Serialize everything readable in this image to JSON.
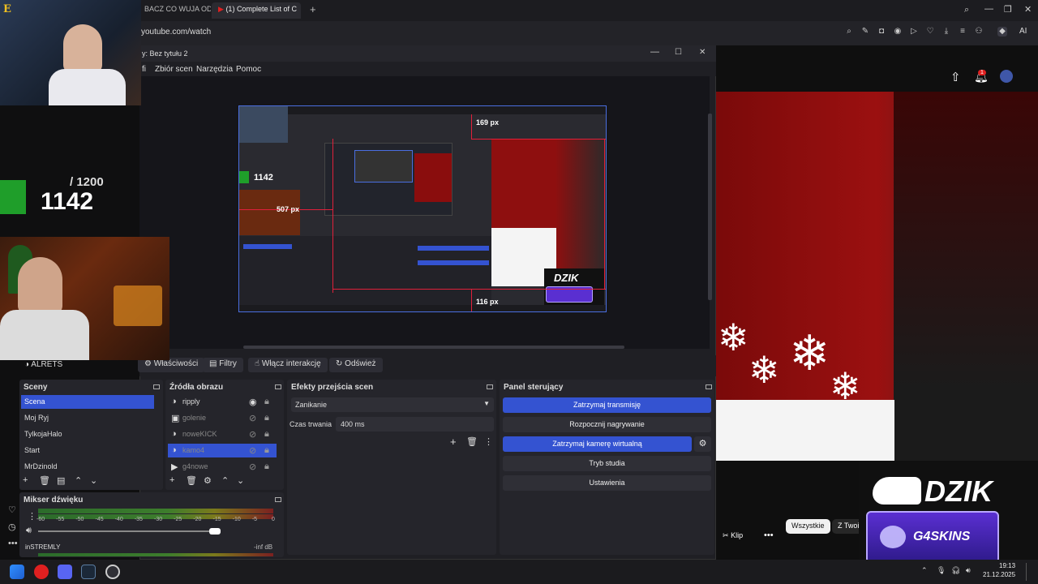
{
  "browser": {
    "tabs": [
      {
        "label": "BACZ CO WUJA ODPIE"
      },
      {
        "label": "(1) Complete List of C"
      }
    ],
    "new_tab_label": "+",
    "url": "youtube.com/watch",
    "ai_label": "AI"
  },
  "obs": {
    "window_title": "y: Bez tytułu 2",
    "menu": [
      "fi",
      "Zbiór scen",
      "Narzędzia",
      "Pomoc"
    ],
    "preview": {
      "measure_top": "169 px",
      "measure_left": "507 px",
      "measure_bottom": "116 px",
      "counter_value": "1142"
    },
    "selected_source_label": "ALRETS",
    "toolbar": {
      "properties": "Właściwości",
      "filters": "Filtry",
      "interact": "Włącz interakcję",
      "refresh": "Odśwież"
    },
    "scenes": {
      "title": "Sceny",
      "items": [
        "Scena",
        "Moj Ryj",
        "TylkojaHalo",
        "Start",
        "MrDzinold"
      ]
    },
    "sources": {
      "title": "Źródła obrazu",
      "items": [
        "ripply",
        "golenie",
        "noweKICK",
        "kamo4",
        "g4nowe"
      ]
    },
    "transitions": {
      "title": "Efekty przejścia scen",
      "selected": "Zanikanie",
      "duration_label": "Czas trwania",
      "duration_value": "400 ms"
    },
    "controls": {
      "title": "Panel sterujący",
      "stop_stream": "Zatrzymaj transmisję",
      "start_recording": "Rozpocznij nagrywanie",
      "stop_virtual_cam": "Zatrzymaj kamerę wirtualną",
      "studio_mode": "Tryb studia",
      "settings": "Ustawienia"
    },
    "mixer": {
      "title": "Mikser dźwięku",
      "ticks": [
        "-60",
        "-55",
        "-50",
        "-45",
        "-40",
        "-35",
        "-30",
        "-25",
        "-20",
        "-15",
        "-10",
        "-5",
        "0"
      ],
      "channel2_name": "inSTREMLY",
      "channel2_level": "-inf dB"
    }
  },
  "overlay": {
    "counter": "1142",
    "counter_total": "/ 1200",
    "brand": "DZIK",
    "sponsor": "G4SKINS"
  },
  "youtube": {
    "notification_count": "1",
    "chips": [
      "Wszystkie",
      "Z Twoich"
    ],
    "clip_label": "Klip"
  },
  "taskbar": {
    "time": "19:13",
    "date": "21.12.2025"
  }
}
